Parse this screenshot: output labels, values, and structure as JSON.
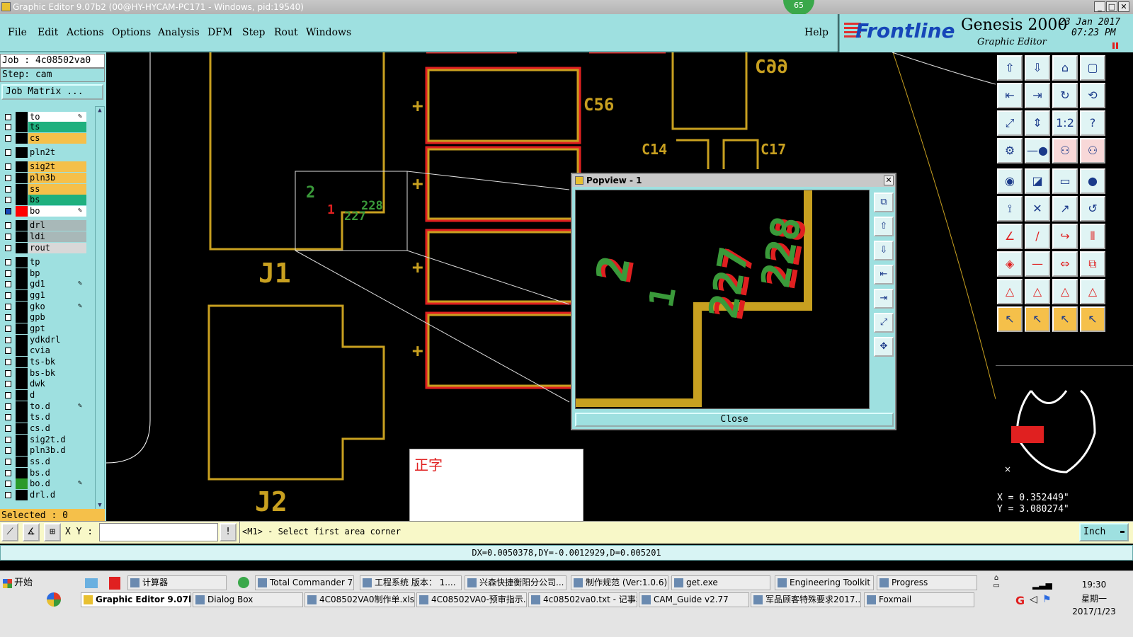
{
  "window": {
    "title": "Graphic Editor 9.07b2 (00@HY-HYCAM-PC171 - Windows, pid:19540)",
    "badge": "65"
  },
  "menu": [
    "File",
    "Edit",
    "Actions",
    "Options",
    "Analysis",
    "DFM",
    "Step",
    "Rout",
    "Windows"
  ],
  "help": "Help",
  "brand": {
    "logo": "Frontline",
    "product": "Genesis 2000",
    "subtitle": "Graphic Editor",
    "date": "23 Jan 2017",
    "time": "07:23 PM"
  },
  "job": {
    "job_line": "Job : 4c08502va0",
    "step_line": "Step: cam",
    "matrix_button": "Job Matrix ..."
  },
  "layers": [
    {
      "name": "to",
      "color": "#ffffff",
      "pen": true
    },
    {
      "name": "ts",
      "color": "#1fb07e"
    },
    {
      "name": "cs",
      "color": "#f5c04a"
    },
    {
      "name": "pln2t",
      "color": "#9ee0e0"
    },
    {
      "name": "sig2t",
      "color": "#f5c04a"
    },
    {
      "name": "pln3b",
      "color": "#f5c04a"
    },
    {
      "name": "ss",
      "color": "#f5c04a"
    },
    {
      "name": "bs",
      "color": "#1fb07e"
    },
    {
      "name": "bo",
      "color": "#ffffff",
      "pen": true,
      "swatch": "#ff0000"
    },
    {
      "name": "drl",
      "color": "#a8b8b8"
    },
    {
      "name": "ldi",
      "color": "#a8b8b8"
    },
    {
      "name": "rout",
      "color": "#d8d8d8"
    },
    {
      "name": "tp",
      "color": "#9ee0e0"
    },
    {
      "name": "bp",
      "color": "#9ee0e0"
    },
    {
      "name": "gd1",
      "color": "#9ee0e0",
      "pen": true
    },
    {
      "name": "gg1",
      "color": "#9ee0e0"
    },
    {
      "name": "gko",
      "color": "#9ee0e0",
      "pen": true
    },
    {
      "name": "gpb",
      "color": "#9ee0e0"
    },
    {
      "name": "gpt",
      "color": "#9ee0e0"
    },
    {
      "name": "ydkdrl",
      "color": "#9ee0e0"
    },
    {
      "name": "cvia",
      "color": "#9ee0e0"
    },
    {
      "name": "ts-bk",
      "color": "#9ee0e0"
    },
    {
      "name": "bs-bk",
      "color": "#9ee0e0"
    },
    {
      "name": "dwk",
      "color": "#9ee0e0"
    },
    {
      "name": "d",
      "color": "#9ee0e0"
    },
    {
      "name": "to.d",
      "color": "#9ee0e0",
      "pen": true
    },
    {
      "name": "ts.d",
      "color": "#9ee0e0"
    },
    {
      "name": "cs.d",
      "color": "#9ee0e0"
    },
    {
      "name": "sig2t.d",
      "color": "#9ee0e0"
    },
    {
      "name": "pln3b.d",
      "color": "#9ee0e0"
    },
    {
      "name": "ss.d",
      "color": "#9ee0e0"
    },
    {
      "name": "bs.d",
      "color": "#9ee0e0"
    },
    {
      "name": "bo.d",
      "color": "#9ee0e0",
      "pen": true,
      "swatch": "#2a9a2a"
    },
    {
      "name": "drl.d",
      "color": "#9ee0e0"
    }
  ],
  "selected": "Selected : 0",
  "canvas_labels": {
    "c99": "C99",
    "c56": "C56",
    "c14": "C14",
    "c17": "C17",
    "j1": "J1",
    "j2": "J2",
    "pin2": "2",
    "pin1": "1",
    "pin227": "227",
    "pin228": "228"
  },
  "popview": {
    "title": "Popview - 1",
    "close": "Close"
  },
  "note_box": {
    "text": "正字"
  },
  "coords": {
    "x": "X = 0.352449\"",
    "y": "Y = 3.080274\""
  },
  "cmd": {
    "xy_label": "X Y :",
    "xy_value": "",
    "prompt": "<M1> - Select first area corner",
    "units": "Inch"
  },
  "status": "DX=0.0050378,DY=-0.0012929,D=0.005201",
  "taskbar": {
    "start": "开始",
    "row1": [
      "计算器",
      "Total Commander 7.0 ...",
      "工程系统  版本： 1....",
      "兴森快捷衡阳分公司...",
      "制作规范 (Ver:1.0.6)",
      "get.exe",
      "Engineering Toolkit 9....",
      "Progress"
    ],
    "row2": [
      "Graphic Editor 9.07b2 ...",
      "Dialog Box",
      "4C08502VA0制作单.xls ...",
      "4C08502VA0-预审指示....",
      "4c08502va0.txt - 记事本",
      "CAM_Guide v2.77",
      "军品顾客特殊要求2017....",
      "Foxmail"
    ],
    "clock": "19:30",
    "weekday": "星期一",
    "date": "2017/1/23"
  }
}
